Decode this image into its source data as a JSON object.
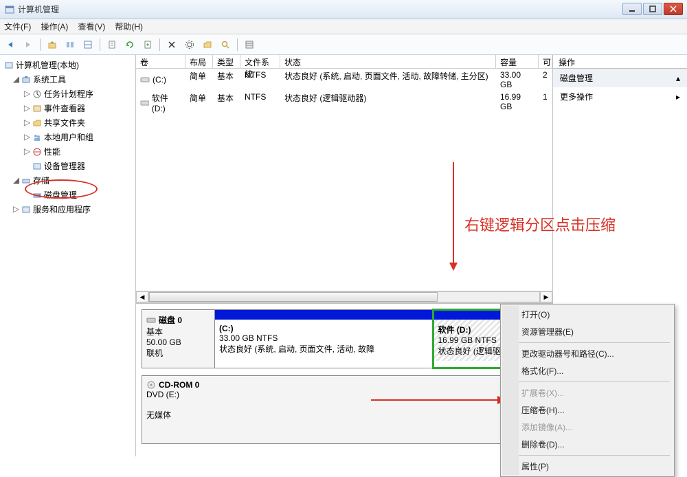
{
  "window": {
    "title": "计算机管理"
  },
  "menu": {
    "file": "文件(F)",
    "action": "操作(A)",
    "view": "查看(V)",
    "help": "帮助(H)"
  },
  "tree": {
    "root": "计算机管理(本地)",
    "system_tools": "系统工具",
    "task_scheduler": "任务计划程序",
    "event_viewer": "事件查看器",
    "shared_folders": "共享文件夹",
    "local_users": "本地用户和组",
    "performance": "性能",
    "device_manager": "设备管理器",
    "storage": "存储",
    "disk_management": "磁盘管理",
    "services": "服务和应用程序"
  },
  "vol_headers": {
    "volume": "卷",
    "layout": "布局",
    "type": "类型",
    "fs": "文件系统",
    "status": "状态",
    "capacity": "容量",
    "free": "可"
  },
  "volumes": [
    {
      "name": "(C:)",
      "layout": "简单",
      "type": "基本",
      "fs": "NTFS",
      "status": "状态良好 (系统, 启动, 页面文件, 活动, 故障转储, 主分区)",
      "cap": "33.00 GB",
      "free": "2"
    },
    {
      "name": "软件 (D:)",
      "layout": "简单",
      "type": "基本",
      "fs": "NTFS",
      "status": "状态良好 (逻辑驱动器)",
      "cap": "16.99 GB",
      "free": "1"
    }
  ],
  "disk0": {
    "label": "磁盘 0",
    "type": "基本",
    "size": "50.00 GB",
    "status": "联机",
    "c": {
      "name": "(C:)",
      "size": "33.00 GB NTFS",
      "status": "状态良好 (系统, 启动, 页面文件, 活动, 故障"
    },
    "d": {
      "name": "软件   (D:)",
      "size": "16.99 GB NTFS",
      "status": "状态良好 (逻辑驱动器)"
    }
  },
  "cdrom": {
    "label": "CD-ROM 0",
    "type": "DVD (E:)",
    "status": "无媒体"
  },
  "ctx": {
    "open": "打开(O)",
    "explorer": "资源管理器(E)",
    "change_letter": "更改驱动器号和路径(C)...",
    "format": "格式化(F)...",
    "extend": "扩展卷(X)...",
    "shrink": "压缩卷(H)...",
    "mirror": "添加镜像(A)...",
    "delete": "删除卷(D)...",
    "properties": "属性(P)"
  },
  "actions": {
    "header": "操作",
    "item1": "磁盘管理",
    "item2": "更多操作"
  },
  "annotations": {
    "text": "右键逻辑分区点击压缩"
  }
}
